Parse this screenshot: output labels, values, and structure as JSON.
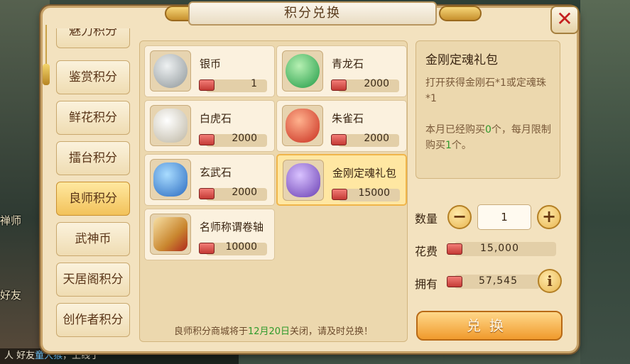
{
  "window": {
    "title": "积分兑换",
    "close_symbol": "✕"
  },
  "background": {
    "side_labels": [
      "禅师",
      "好友"
    ],
    "chat": {
      "prefix": "人 好友",
      "name": "童大猴",
      "suffix": "，上线了"
    }
  },
  "tabs": [
    {
      "label": "魅力积分",
      "active": false
    },
    {
      "label": "鉴赏积分",
      "active": false
    },
    {
      "label": "鲜花积分",
      "active": false
    },
    {
      "label": "擂台积分",
      "active": false
    },
    {
      "label": "良师积分",
      "active": true
    },
    {
      "label": "武神币",
      "active": false
    },
    {
      "label": "天居阁积分",
      "active": false
    },
    {
      "label": "创作者积分",
      "active": false
    }
  ],
  "items": [
    {
      "name": "银币",
      "price": "1",
      "icon": "silver-coin-icon",
      "color": "#a9b1b5",
      "selected": false
    },
    {
      "name": "青龙石",
      "price": "2000",
      "icon": "green-dragon-stone-icon",
      "color": "#3fbf6a",
      "selected": false
    },
    {
      "name": "白虎石",
      "price": "2000",
      "icon": "white-tiger-stone-icon",
      "color": "#e9e4d6",
      "selected": false
    },
    {
      "name": "朱雀石",
      "price": "2000",
      "icon": "vermilion-bird-stone-icon",
      "color": "#e0513a",
      "selected": false
    },
    {
      "name": "玄武石",
      "price": "2000",
      "icon": "black-tortoise-stone-icon",
      "color": "#3f86d6",
      "selected": false
    },
    {
      "name": "金刚定魂礼包",
      "price": "15000",
      "icon": "gift-bag-icon",
      "color": "#8a5fc7",
      "selected": true
    },
    {
      "name": "名师称谓卷轴",
      "price": "10000",
      "icon": "scroll-icon",
      "color": "#d9a04a",
      "selected": false
    }
  ],
  "notice": {
    "prefix": "良师积分商城将于",
    "date": "12月20日",
    "suffix": "关闭，请及时兑换！"
  },
  "detail": {
    "title": "金刚定魂礼包",
    "description": "打开获得金刚石*1或定魂珠*1",
    "limit_prefix": "本月已经购买",
    "limit_bought": "0",
    "limit_mid": "个，每月限制购买",
    "limit_max": "1",
    "limit_suffix": "个。"
  },
  "purchase": {
    "quantity_label": "数量",
    "quantity": "1",
    "minus": "−",
    "plus": "+",
    "cost_label": "花费",
    "cost": "15,000",
    "owned_label": "拥有",
    "owned": "57,545",
    "info_symbol": "i",
    "exchange_label": "兑换"
  },
  "colors": {
    "accent": "#f0b54a",
    "highlight_green": "#2e9a2b",
    "close_red": "#c41e1e"
  }
}
